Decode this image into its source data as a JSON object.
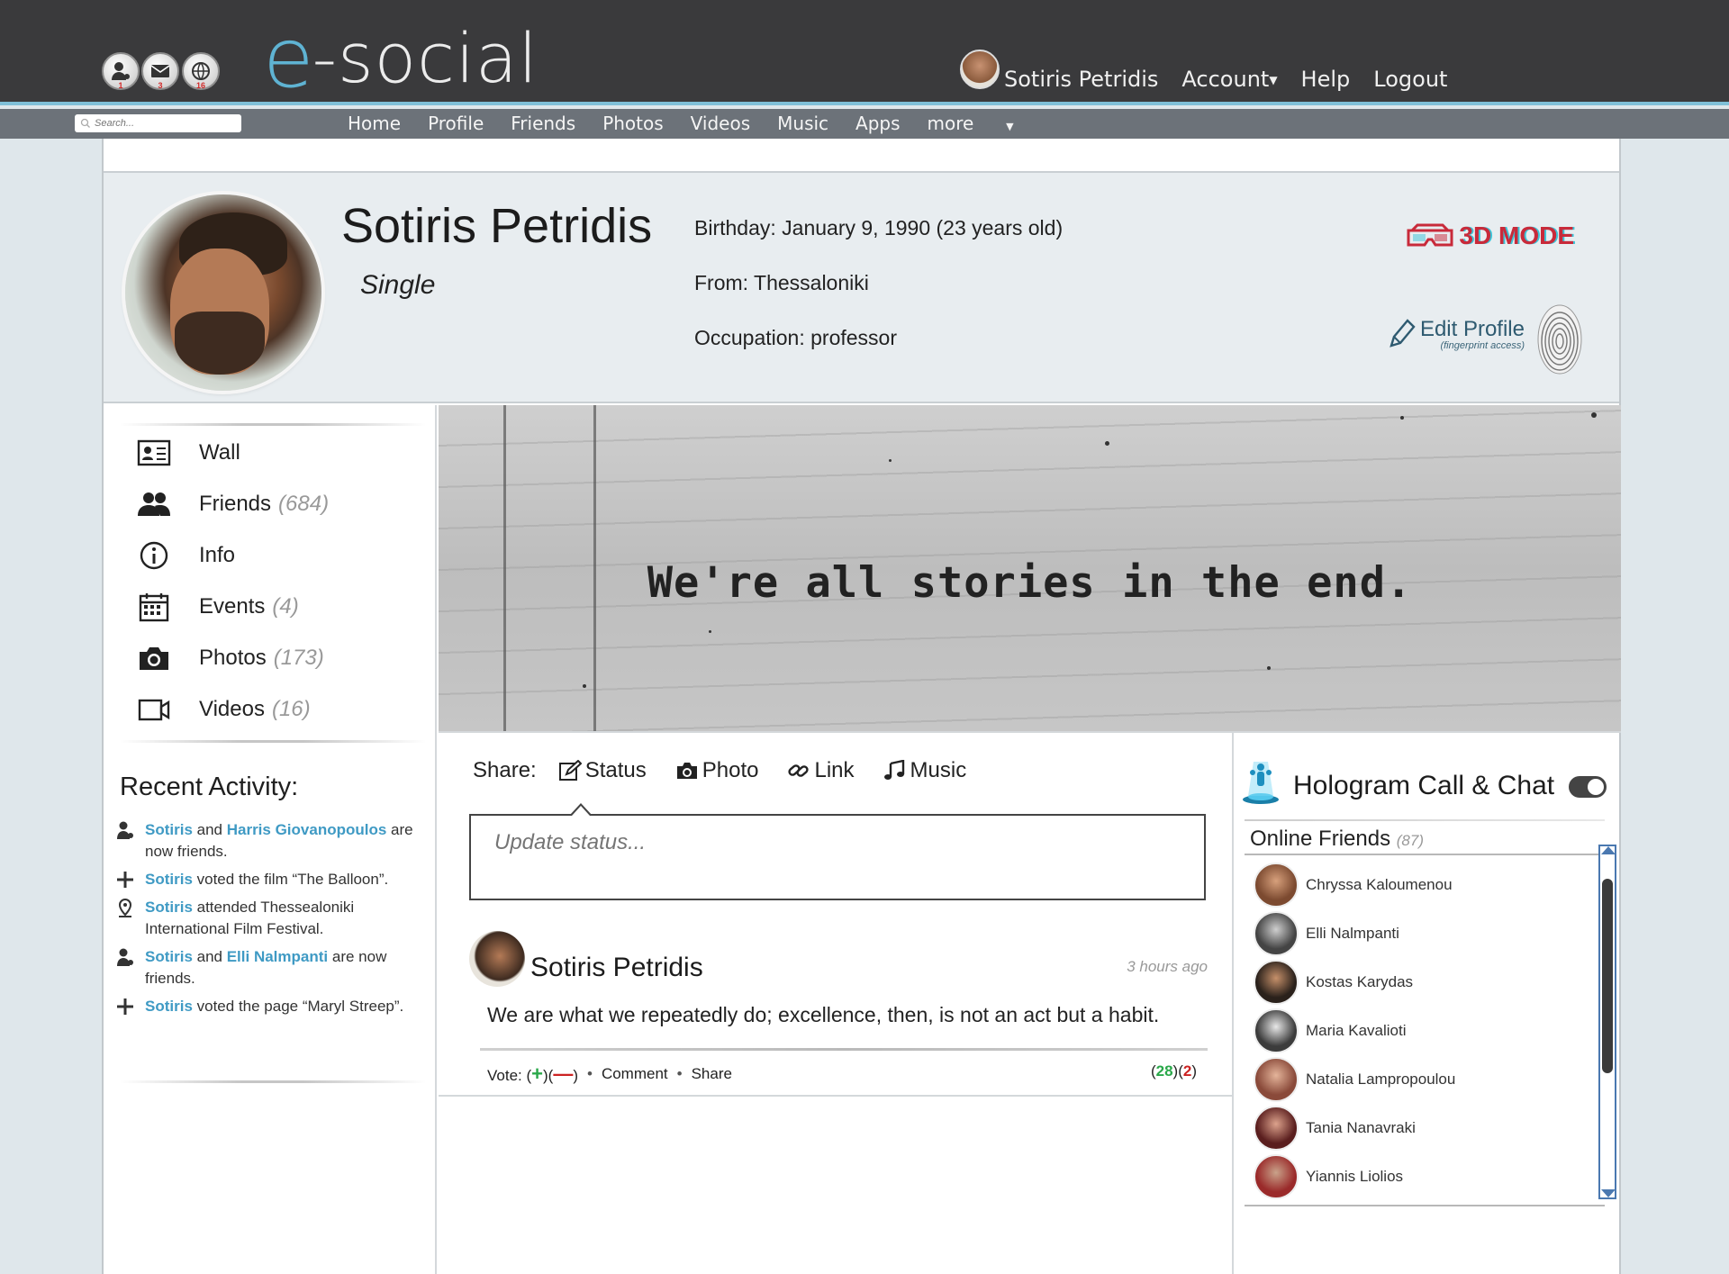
{
  "app": {
    "logo_e": "e",
    "logo_rest": "-social"
  },
  "notifications": [
    {
      "icon": "friend-request-icon",
      "count": "1"
    },
    {
      "icon": "messages-icon",
      "count": "3"
    },
    {
      "icon": "globe-icon",
      "count": "16"
    }
  ],
  "topnav": {
    "user_name": "Sotiris Petridis",
    "account": "Account",
    "help": "Help",
    "logout": "Logout"
  },
  "search": {
    "placeholder": "Search..."
  },
  "nav": {
    "items": [
      "Home",
      "Profile",
      "Friends",
      "Photos",
      "Videos",
      "Music",
      "Apps"
    ],
    "more": "more"
  },
  "profile": {
    "name": "Sotiris Petridis",
    "relationship": "Single",
    "birthday": "Birthday: January 9, 1990 (23 years old)",
    "from": "From: Thessaloniki",
    "occupation": "Occupation: professor",
    "mode_3d": "3D MODE",
    "edit_profile": "Edit Profile",
    "edit_profile_sub": "(fingerprint access)"
  },
  "sidebar": {
    "items": [
      {
        "label": "Wall",
        "count": "",
        "icon": "id-card-icon"
      },
      {
        "label": "Friends",
        "count": "(684)",
        "icon": "friends-icon"
      },
      {
        "label": "Info",
        "count": "",
        "icon": "info-icon"
      },
      {
        "label": "Events",
        "count": "(4)",
        "icon": "calendar-icon"
      },
      {
        "label": "Photos",
        "count": "(173)",
        "icon": "camera-icon"
      },
      {
        "label": "Videos",
        "count": "(16)",
        "icon": "video-icon"
      }
    ]
  },
  "recent_activity": {
    "title": "Recent Activity:",
    "items": [
      {
        "icon": "friend-icon",
        "a": "Sotiris",
        "b": " and ",
        "c": "Harris Giovanopoulos",
        "d": " are now friends."
      },
      {
        "icon": "plus-icon",
        "a": "Sotiris",
        "b": " voted the film “The Balloon”.",
        "c": "",
        "d": ""
      },
      {
        "icon": "location-icon",
        "a": "Sotiris",
        "b": " attended Thessealoniki International Film Festival.",
        "c": "",
        "d": ""
      },
      {
        "icon": "friend-icon",
        "a": "Sotiris",
        "b": " and ",
        "c": "Elli Nalmpanti",
        "d": " are now friends."
      },
      {
        "icon": "plus-icon",
        "a": "Sotiris",
        "b": " voted the page “Maryl Streep”.",
        "c": "",
        "d": ""
      }
    ]
  },
  "cover": {
    "quote": "We're all stories in the end."
  },
  "share": {
    "label": "Share:",
    "status": "Status",
    "photo": "Photo",
    "link": "Link",
    "music": "Music",
    "placeholder": "Update status..."
  },
  "post": {
    "author": "Sotiris Petridis",
    "time": "3 hours ago",
    "text": "We are what we repeatedly do; excellence, then, is not an act but a habit.",
    "vote_label": "Vote: (",
    "vote_plus": "+",
    "vote_mid": ")(",
    "vote_minus": "—",
    "vote_end": ")",
    "comment": "Comment",
    "share": "Share",
    "up": "28",
    "down": "2"
  },
  "chat": {
    "title": "Hologram Call & Chat",
    "online_title": "Online Friends",
    "online_count": "(87)",
    "friends": [
      "Chryssa Kaloumenou",
      "Elli Nalmpanti",
      "Kostas Karydas",
      "Maria Kavalioti",
      "Natalia Lampropoulou",
      "Tania Nanavraki",
      "Yiannis Liolios"
    ]
  },
  "colors": {
    "accent": "#5fb3d3",
    "link": "#3f9ac4",
    "topbar": "#3a3a3c",
    "navbar": "#6c7279",
    "vote_up": "#2aa84a",
    "vote_down": "#cc2222"
  }
}
